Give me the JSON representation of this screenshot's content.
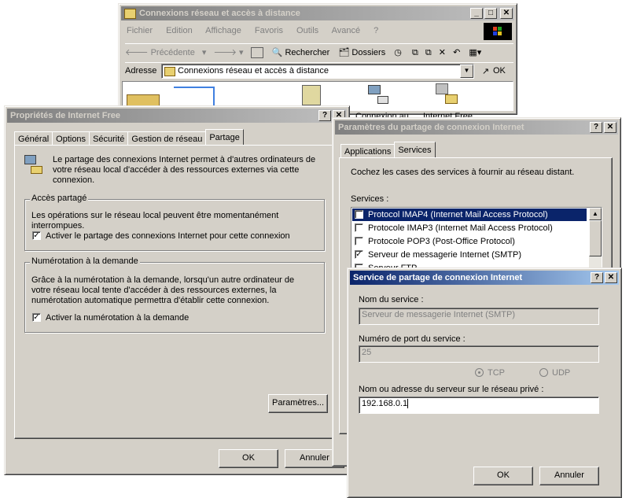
{
  "explorer": {
    "title": "Connexions réseau et accès à distance",
    "menu": [
      "Fichier",
      "Edition",
      "Affichage",
      "Favoris",
      "Outils",
      "Avancé",
      "?"
    ],
    "toolbar": {
      "back": "Précédente",
      "search": "Rechercher",
      "folders": "Dossiers"
    },
    "address_label": "Adresse",
    "address_value": "Connexions réseau et accès à distance",
    "go_label": "OK",
    "icons": [
      "Connexion au",
      "Internet Free"
    ]
  },
  "props": {
    "title": "Propriétés de Internet Free",
    "tabs": [
      "Général",
      "Options",
      "Sécurité",
      "Gestion de réseau",
      "Partage"
    ],
    "intro": "Le partage des connexions Internet permet à d'autres ordinateurs de votre réseau local d'accéder à des ressources externes via cette connexion.",
    "shared_group": "Accès partagé",
    "shared_text": "Les opérations sur le réseau local peuvent être momentanément interrompues.",
    "shared_check": "Activer le partage des connexions Internet pour cette connexion",
    "dial_group": "Numérotation à la demande",
    "dial_text": "Grâce à la numérotation à la demande, lorsqu'un autre ordinateur de votre réseau local tente d'accéder à des ressources externes, la numérotation automatique permettra d'établir cette connexion.",
    "dial_check": "Activer la numérotation à la demande",
    "params_btn": "Paramètres...",
    "ok": "OK",
    "cancel": "Annuler"
  },
  "params": {
    "title": "Paramètres du partage de connexion Internet",
    "tabs": [
      "Applications",
      "Services"
    ],
    "intro": "Cochez les cases des services à fournir au réseau distant.",
    "services_label": "Services :",
    "services": [
      {
        "label": "Protocol IMAP4 (Internet Mail Access Protocol)",
        "checked": false,
        "selected": true
      },
      {
        "label": "Protocole IMAP3 (Internet Mail Access Protocol)",
        "checked": false,
        "selected": false
      },
      {
        "label": "Protocole POP3 (Post-Office Protocol)",
        "checked": false,
        "selected": false
      },
      {
        "label": "Serveur de messagerie Internet (SMTP)",
        "checked": true,
        "selected": false
      },
      {
        "label": "Serveur FTP",
        "checked": false,
        "selected": false
      }
    ]
  },
  "service": {
    "title": "Service de partage de connexion Internet",
    "name_label": "Nom du service :",
    "name_value": "Serveur de messagerie Internet (SMTP)",
    "port_label": "Numéro de port du service :",
    "port_value": "25",
    "tcp": "TCP",
    "udp": "UDP",
    "server_label": "Nom ou adresse du serveur sur le réseau privé :",
    "server_value": "192.168.0.1",
    "ok": "OK",
    "cancel": "Annuler"
  }
}
